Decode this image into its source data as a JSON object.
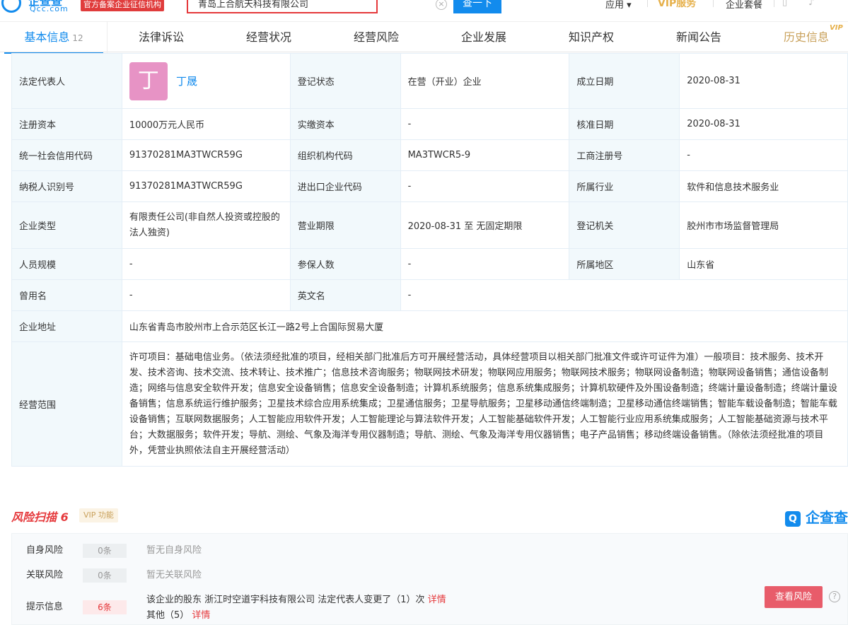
{
  "header": {
    "logo_cn": "企查查",
    "logo_en": "Qcc.com",
    "official_badge": "官方备案企业征信机构",
    "search_value": "青岛上合航天科技有限公司",
    "search_button": "查一下",
    "apps": "应用 ▾",
    "vip": "VIP服务",
    "packages": "企业套餐"
  },
  "tabs": [
    {
      "label": "基本信息",
      "count": "12"
    },
    {
      "label": "法律诉讼"
    },
    {
      "label": "经营状况"
    },
    {
      "label": "经营风险"
    },
    {
      "label": "企业发展"
    },
    {
      "label": "知识产权"
    },
    {
      "label": "新闻公告"
    },
    {
      "label": "历史信息"
    }
  ],
  "vip_tag": "VIP",
  "info": {
    "legal_rep_label": "法定代表人",
    "legal_rep_avatar": "丁",
    "legal_rep_name": "丁晟",
    "reg_status_label": "登记状态",
    "reg_status": "在营（开业）企业",
    "founded_label": "成立日期",
    "founded": "2020-08-31",
    "reg_capital_label": "注册资本",
    "reg_capital": "10000万元人民币",
    "paid_capital_label": "实缴资本",
    "paid_capital": "-",
    "approved_label": "核准日期",
    "approved": "2020-08-31",
    "credit_code_label": "统一社会信用代码",
    "credit_code": "91370281MA3TWCR59G",
    "org_code_label": "组织机构代码",
    "org_code": "MA3TWCR5-9",
    "biz_reg_label": "工商注册号",
    "biz_reg": "-",
    "taxpayer_label": "纳税人识别号",
    "taxpayer": "91370281MA3TWCR59G",
    "import_export_label": "进出口企业代码",
    "import_export": "-",
    "industry_label": "所属行业",
    "industry": "软件和信息技术服务业",
    "company_type_label": "企业类型",
    "company_type": "有限责任公司(非自然人投资或控股的法人独资)",
    "term_label": "营业期限",
    "term": "2020-08-31 至 无固定期限",
    "authority_label": "登记机关",
    "authority": "胶州市市场监督管理局",
    "staff_label": "人员规模",
    "staff": "-",
    "insured_label": "参保人数",
    "insured": "-",
    "region_label": "所属地区",
    "region": "山东省",
    "former_name_label": "曾用名",
    "former_name": "-",
    "english_name_label": "英文名",
    "english_name": "-",
    "address_label": "企业地址",
    "address": "山东省青岛市胶州市上合示范区长江一路2号上合国际贸易大厦",
    "scope_label": "经营范围",
    "scope": "许可项目：基础电信业务。（依法须经批准的项目，经相关部门批准后方可开展经营活动，具体经营项目以相关部门批准文件或许可证件为准）一般项目：技术服务、技术开发、技术咨询、技术交流、技术转让、技术推广；信息技术咨询服务；物联网技术研发；物联网应用服务；物联网技术服务；物联网设备制造；物联网设备销售；通信设备制造；网络与信息安全软件开发；信息安全设备销售；信息安全设备制造；计算机系统服务；信息系统集成服务；计算机软硬件及外围设备制造；终端计量设备制造；终端计量设备销售；信息系统运行维护服务；卫星技术综合应用系统集成；卫星通信服务；卫星导航服务；卫星移动通信终端制造；卫星移动通信终端销售；智能车载设备制造；智能车载设备销售；互联网数据服务；人工智能应用软件开发；人工智能理论与算法软件开发；人工智能基础软件开发；人工智能行业应用系统集成服务；人工智能基础资源与技术平台；大数据服务；软件开发；导航、测绘、气象及海洋专用仪器制造；导航、测绘、气象及海洋专用仪器销售；电子产品销售；移动终端设备销售。（除依法须经批准的项目外，凭营业执照依法自主开展经营活动）"
  },
  "risk": {
    "title": "风险扫描 6",
    "vip_tag": "VIP 功能",
    "brand": "企查查",
    "rows": [
      {
        "label": "自身风险",
        "count": "0条",
        "text": "暂无自身风险"
      },
      {
        "label": "关联风险",
        "count": "0条",
        "text": "暂无关联风险"
      },
      {
        "label": "提示信息",
        "count": "6条",
        "text": "该企业的股东 浙江时空道宇科技有限公司 法定代表人变更了（1）次",
        "link": "详情"
      }
    ],
    "extra_text": "其他（5）",
    "extra_link": "详情",
    "check_button": "查看风险"
  }
}
